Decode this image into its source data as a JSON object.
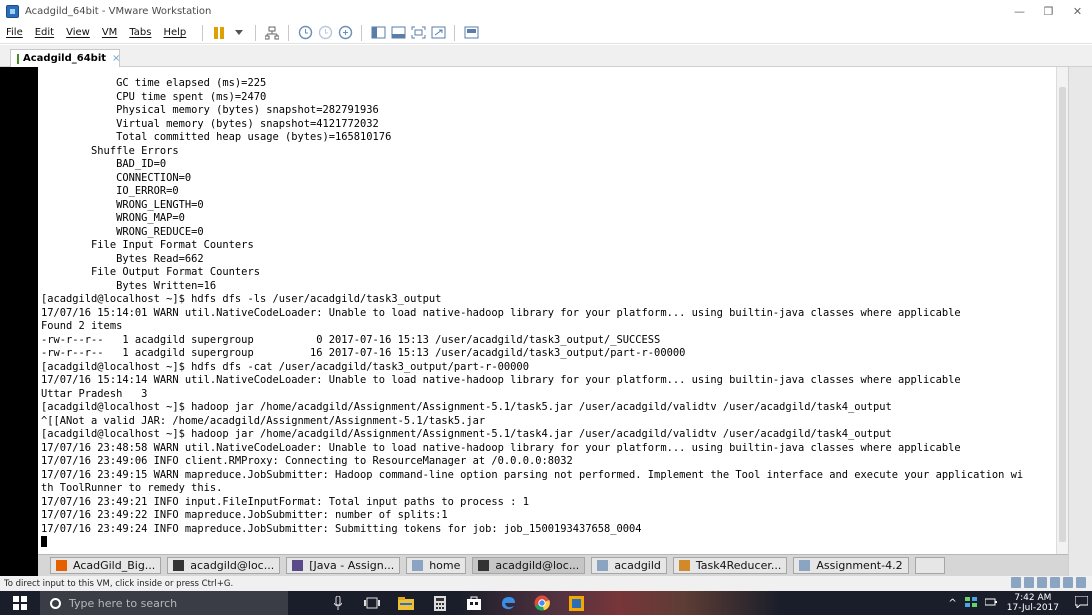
{
  "window": {
    "title": "Acadgild_64bit - VMware Workstation",
    "controls": {
      "minimize": "—",
      "maximize": "❐",
      "close": "✕"
    }
  },
  "menu": [
    "File",
    "Edit",
    "View",
    "VM",
    "Tabs",
    "Help"
  ],
  "toolbar_icons": [
    "power-pause-icon",
    "dropdown-icon",
    "network-icon",
    "snapshot-icon",
    "snapshot-revert-icon",
    "snapshot-manager-icon",
    "unity-icon",
    "console-view-icon",
    "fullscreen-icon",
    "stretch-icon",
    "thumbnail-icon"
  ],
  "tab": {
    "label": "Acadgild_64bit",
    "close": "×"
  },
  "terminal": {
    "lines": [
      "            GC time elapsed (ms)=225",
      "            CPU time spent (ms)=2470",
      "            Physical memory (bytes) snapshot=282791936",
      "            Virtual memory (bytes) snapshot=4121772032",
      "            Total committed heap usage (bytes)=165810176",
      "        Shuffle Errors",
      "            BAD_ID=0",
      "            CONNECTION=0",
      "            IO_ERROR=0",
      "            WRONG_LENGTH=0",
      "            WRONG_MAP=0",
      "            WRONG_REDUCE=0",
      "        File Input Format Counters",
      "            Bytes Read=662",
      "        File Output Format Counters",
      "            Bytes Written=16",
      "[acadgild@localhost ~]$ hdfs dfs -ls /user/acadgild/task3_output",
      "17/07/16 15:14:01 WARN util.NativeCodeLoader: Unable to load native-hadoop library for your platform... using builtin-java classes where applicable",
      "Found 2 items",
      "-rw-r--r--   1 acadgild supergroup          0 2017-07-16 15:13 /user/acadgild/task3_output/_SUCCESS",
      "-rw-r--r--   1 acadgild supergroup         16 2017-07-16 15:13 /user/acadgild/task3_output/part-r-00000",
      "[acadgild@localhost ~]$ hdfs dfs -cat /user/acadgild/task3_output/part-r-00000",
      "17/07/16 15:14:14 WARN util.NativeCodeLoader: Unable to load native-hadoop library for your platform... using builtin-java classes where applicable",
      "Uttar Pradesh   3",
      "[acadgild@localhost ~]$ hadoop jar /home/acadgild/Assignment/Assignment-5.1/task5.jar /user/acadgild/validtv /user/acadgild/task4_output",
      "^[[ANot a valid JAR: /home/acadgild/Assignment/Assignment-5.1/task5.jar",
      "[acadgild@localhost ~]$ hadoop jar /home/acadgild/Assignment/Assignment-5.1/task4.jar /user/acadgild/validtv /user/acadgild/task4_output",
      "17/07/16 23:48:58 WARN util.NativeCodeLoader: Unable to load native-hadoop library for your platform... using builtin-java classes where applicable",
      "17/07/16 23:49:06 INFO client.RMProxy: Connecting to ResourceManager at /0.0.0.0:8032",
      "17/07/16 23:49:15 WARN mapreduce.JobSubmitter: Hadoop command-line option parsing not performed. Implement the Tool interface and execute your application wi",
      "th ToolRunner to remedy this.",
      "17/07/16 23:49:21 INFO input.FileInputFormat: Total input paths to process : 1",
      "17/07/16 23:49:22 INFO mapreduce.JobSubmitter: number of splits:1",
      "17/07/16 23:49:24 INFO mapreduce.JobSubmitter: Submitting tokens for job: job_1500193437658_0004"
    ]
  },
  "guest_taskbar": [
    {
      "label": "AcadGild_Big...",
      "icon": "firefox-icon"
    },
    {
      "label": "acadgild@loc...",
      "icon": "terminal-icon"
    },
    {
      "label": "[Java - Assign...",
      "icon": "eclipse-icon"
    },
    {
      "label": "home",
      "icon": "folder-icon"
    },
    {
      "label": "acadgild@loc...",
      "icon": "terminal-icon"
    },
    {
      "label": "acadgild",
      "icon": "folder-icon"
    },
    {
      "label": "Task4Reducer...",
      "icon": "editor-icon"
    },
    {
      "label": "Assignment-4.2",
      "icon": "folder-icon"
    }
  ],
  "status": {
    "text": "To direct input to this VM, click inside or press Ctrl+G."
  },
  "host_taskbar": {
    "search_placeholder": "Type here to search",
    "clock_time": "7:42 AM",
    "clock_date": "17-Jul-2017",
    "tray_up": "^"
  },
  "colors": {
    "terminal_bg": "#ffffff",
    "vm_margin": "#000000",
    "host_taskbar": "#1a1e2a"
  }
}
